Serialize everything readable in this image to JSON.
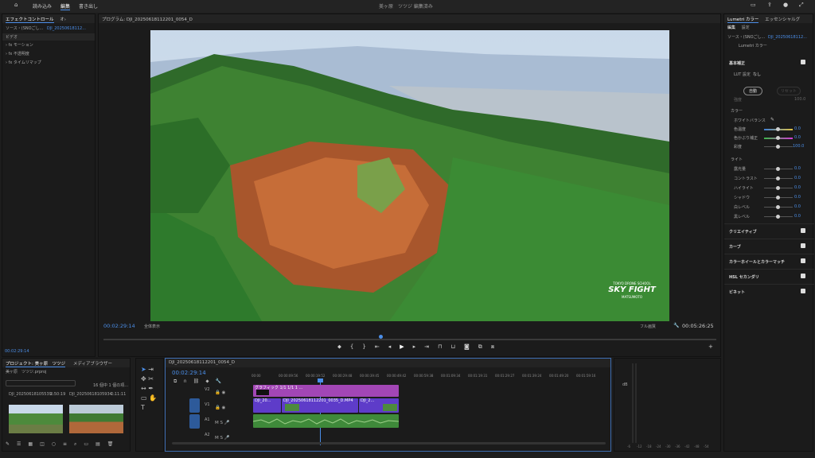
{
  "nav": {
    "import": "読み込み",
    "edit": "編集",
    "export": "書き出し",
    "title": "美ヶ原　ツツジ 編集済み"
  },
  "effect_controls": {
    "tab": "エフェクトコントロール",
    "tab2": "オ›",
    "source": "ソース・(SNOごし...",
    "seq": "DJI_20250618112...",
    "video": "ビデオ",
    "motion": "モーション",
    "opacity": "不透明度",
    "timeremap": "タイムリマップ",
    "time": "00:02:29:14"
  },
  "program": {
    "title": "プログラム: DJI_20250618112201_0054_D",
    "timecode": "00:02:29:14",
    "fit": "全体表示",
    "quality": "フル画質",
    "duration": "00:05:26:25",
    "watermark_small": "TOKYO DRONE SCHOOL",
    "watermark_big": "SKY FIGHT",
    "watermark_sub": "MATSUMOTO"
  },
  "project": {
    "tab": "プロジェクト: 美ヶ原　ツツジ",
    "tab2": "メディアブラウザー",
    "file": "美ヶ原　ツツジ.prproj",
    "count": "16 個中 1 個の項...",
    "items": [
      {
        "name": "DJI_20250618105539...",
        "dur": "2:50:19"
      },
      {
        "name": "DJI_20250618105934...",
        "dur": "2:11:11"
      }
    ]
  },
  "timeline": {
    "tab": "DJI_20250618112201_0054_D",
    "timecode": "00:02:29:14",
    "ruler": [
      "00:00",
      "00:00:09:56",
      "00:00:19:52",
      "00:00:29:48",
      "00:00:39:45",
      "00:00:49:42",
      "00:00:59:38",
      "00:01:09:34",
      "00:01:19:31",
      "00:01:29:27",
      "00:01:39:24",
      "00:01:49:20",
      "00:01:59:16"
    ],
    "tracks": [
      "V2",
      "V1",
      "A1",
      "A2"
    ],
    "clip_v2": "グラフィック 1/1 1/1 1 ...",
    "clip_v1a": "DJI_20...",
    "clip_v1b": "DJI_20250618112201_0035_D.MP4",
    "clip_v1c": "DJI_2..."
  },
  "lumetri": {
    "tab": "Lumetri カラー",
    "tab2": "エッセンシャルグ",
    "sub1": "編集",
    "sub2": "設定",
    "source": "ソース・(SNOごし...",
    "seq": "DJI_20250618112...",
    "fx": "Lumetri カラー",
    "basic": "基本補正",
    "lut_label": "LUT 設定",
    "lut_val": "なし",
    "input": "強度",
    "input_val": "100.0",
    "auto": "自動",
    "reset": "リセット",
    "color": "カラー",
    "wb": "ホワイトバランス",
    "temp": "色温度",
    "temp_val": "0.0",
    "tint": "色かぶり補正",
    "tint_val": "0.0",
    "sat": "彩度",
    "sat_val": "100.0",
    "light": "ライト",
    "lights": [
      {
        "label": "露光量",
        "val": "0.0"
      },
      {
        "label": "コントラスト",
        "val": "0.0"
      },
      {
        "label": "ハイライト",
        "val": "0.0"
      },
      {
        "label": "シャドウ",
        "val": "0.0"
      },
      {
        "label": "白レベル",
        "val": "0.0"
      },
      {
        "label": "黒レベル",
        "val": "0.0"
      }
    ],
    "sections": [
      "クリエイティブ",
      "カーブ",
      "カラーホイールとカラーマッチ",
      "HSL セカンダリ",
      "ビネット"
    ]
  },
  "meter": {
    "labels": [
      "-6",
      "-12",
      "-18",
      "-24",
      "-30",
      "-36",
      "-42",
      "-48",
      "-54"
    ],
    "db": "dB"
  }
}
